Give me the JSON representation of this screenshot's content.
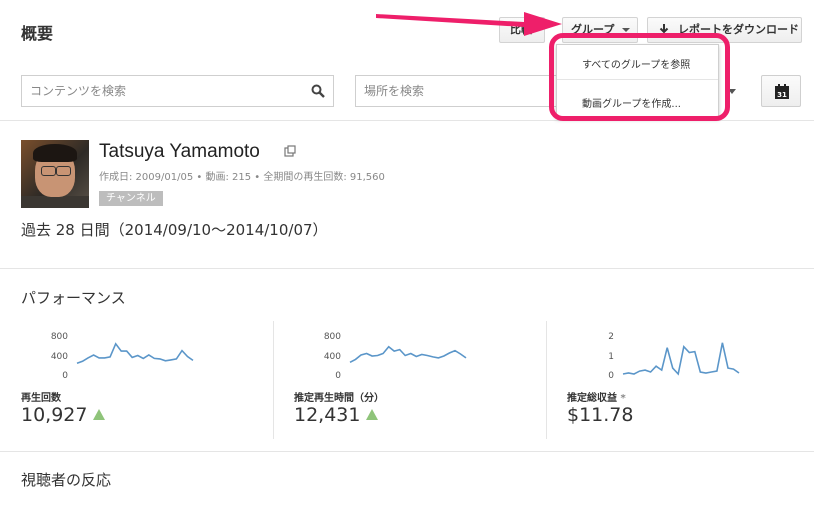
{
  "header": {
    "title": "概要",
    "compare_label": "比較",
    "group_label": "グループ",
    "download_label": "レポートをダウンロード"
  },
  "filters": {
    "content_placeholder": "コンテンツを検索",
    "place_placeholder": "場所を検索",
    "calendar_day": "31"
  },
  "channel": {
    "name": "Tatsuya Yamamoto",
    "meta": "作成日: 2009/01/05 • 動画: 215 • 全期間の再生回数: 91,560",
    "badge": "チャンネル",
    "period": "過去 28 日間（2014/09/10～2014/10/07）"
  },
  "performance": {
    "title": "パフォーマンス",
    "metrics": [
      {
        "label": "再生回数",
        "value": "10,927",
        "trend": "up",
        "axis": [
          "800",
          "400",
          "0"
        ],
        "ymax": 800,
        "series": [
          220,
          260,
          330,
          390,
          330,
          330,
          350,
          620,
          470,
          470,
          340,
          380,
          320,
          390,
          320,
          310,
          270,
          290,
          310,
          480,
          360,
          280
        ]
      },
      {
        "label": "推定再生時間（分）",
        "value": "12,431",
        "trend": "up",
        "axis": [
          "800",
          "400",
          "0"
        ],
        "ymax": 800,
        "series": [
          240,
          300,
          390,
          420,
          370,
          380,
          420,
          560,
          470,
          500,
          380,
          420,
          360,
          400,
          380,
          350,
          330,
          370,
          430,
          480,
          410,
          330
        ]
      },
      {
        "label": "推定総収益",
        "footnote": "*",
        "value": "$11.78",
        "trend": "",
        "axis": [
          "2",
          "1",
          "0"
        ],
        "ymax": 2,
        "series": [
          0.0,
          0.05,
          0.0,
          0.15,
          0.2,
          0.1,
          0.4,
          0.2,
          1.35,
          0.3,
          0.0,
          1.4,
          1.1,
          1.15,
          0.1,
          0.05,
          0.1,
          0.15,
          1.6,
          0.3,
          0.25,
          0.05
        ]
      }
    ]
  },
  "audience": {
    "title": "視聴者の反応"
  },
  "group_menu": {
    "items": [
      "すべてのグループを参照",
      "動画グループを作成..."
    ]
  },
  "colors": {
    "accent_highlight": "#ee1f6a",
    "spark_line": "#5b96c9",
    "trend_up": "#8fc47a"
  }
}
